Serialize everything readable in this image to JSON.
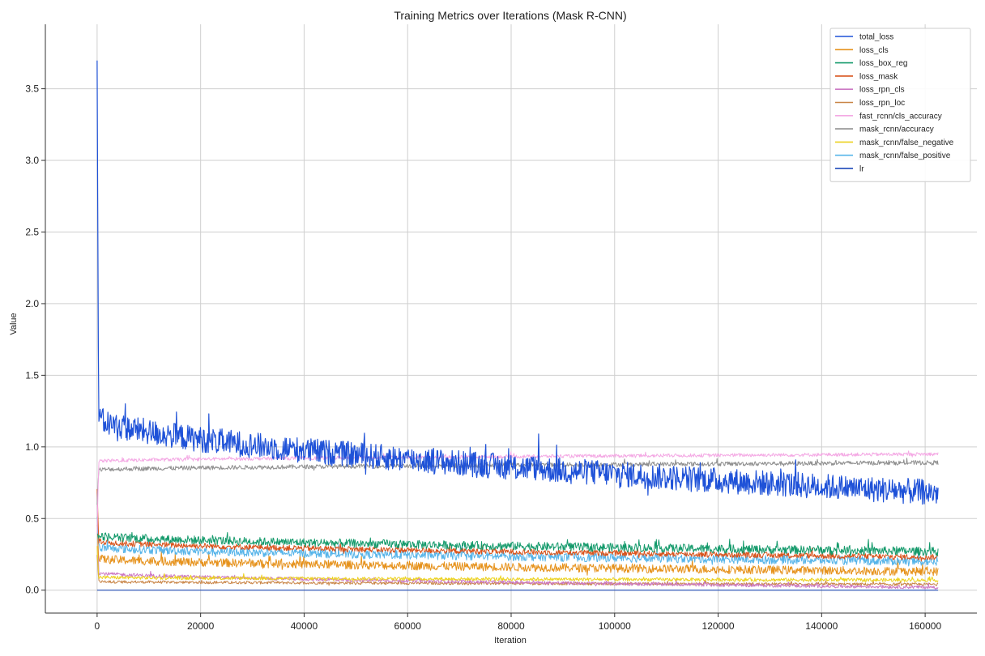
{
  "chart_data": {
    "type": "line",
    "title": "Training Metrics over Iterations (Mask R-CNN)",
    "xlabel": "Iteration",
    "ylabel": "Value",
    "xlim": [
      -10000,
      170000
    ],
    "ylim": [
      -0.16,
      3.95
    ],
    "x_ticks": [
      0,
      20000,
      40000,
      60000,
      80000,
      100000,
      120000,
      140000,
      160000
    ],
    "y_ticks": [
      0.0,
      0.5,
      1.0,
      1.5,
      2.0,
      2.5,
      3.0,
      3.5
    ],
    "x_tick_labels": [
      "0",
      "20000",
      "40000",
      "60000",
      "80000",
      "100000",
      "120000",
      "140000",
      "160000"
    ],
    "y_tick_labels": [
      "0.0",
      "0.5",
      "1.0",
      "1.5",
      "2.0",
      "2.5",
      "3.0",
      "3.5"
    ],
    "grid": true,
    "legend_position": "top-right",
    "x_range": [
      0,
      162500
    ],
    "series": [
      {
        "name": "total_loss",
        "color": "#1f52d8",
        "start": 3.75,
        "early": 1.2,
        "end": 0.68,
        "noise": 0.09
      },
      {
        "name": "loss_cls",
        "color": "#e6921c",
        "start": 0.45,
        "early": 0.22,
        "end": 0.13,
        "noise": 0.03
      },
      {
        "name": "loss_box_reg",
        "color": "#149a6b",
        "start": 0.42,
        "early": 0.38,
        "end": 0.27,
        "noise": 0.03
      },
      {
        "name": "loss_mask",
        "color": "#d9531b",
        "start": 0.7,
        "early": 0.34,
        "end": 0.23,
        "noise": 0.02
      },
      {
        "name": "loss_rpn_cls",
        "color": "#cc79c4",
        "start": 0.69,
        "early": 0.12,
        "end": 0.02,
        "noise": 0.012
      },
      {
        "name": "loss_rpn_loc",
        "color": "#c98547",
        "start": 0.25,
        "early": 0.06,
        "end": 0.04,
        "noise": 0.01
      },
      {
        "name": "fast_rcnn/cls_accuracy",
        "color": "#f4a9e4",
        "start": 0.4,
        "early": 0.9,
        "end": 0.95,
        "noise": 0.012
      },
      {
        "name": "mask_rcnn/accuracy",
        "color": "#8f8f8f",
        "start": 0.6,
        "early": 0.84,
        "end": 0.89,
        "noise": 0.015
      },
      {
        "name": "mask_rcnn/false_negative",
        "color": "#ecd21f",
        "start": 0.3,
        "early": 0.09,
        "end": 0.07,
        "noise": 0.012
      },
      {
        "name": "mask_rcnn/false_positive",
        "color": "#56b4e9",
        "start": 0.5,
        "early": 0.3,
        "end": 0.2,
        "noise": 0.03
      },
      {
        "name": "lr",
        "color": "#0b3ab3",
        "start": 0.0,
        "early": 0.0,
        "end": 0.0,
        "noise": 0.0
      }
    ]
  }
}
